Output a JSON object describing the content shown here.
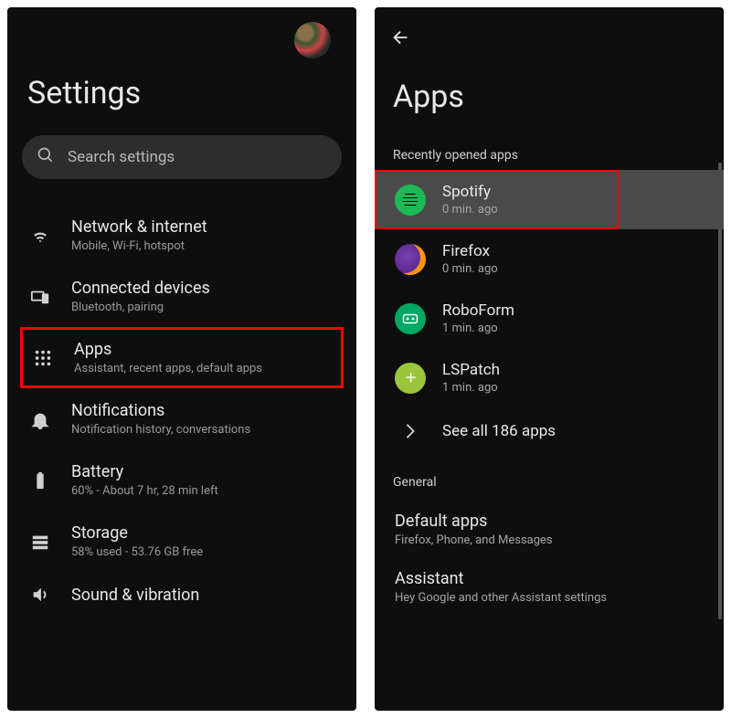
{
  "left": {
    "title": "Settings",
    "search_placeholder": "Search settings",
    "items": [
      {
        "title": "Network & internet",
        "sub": "Mobile, Wi-Fi, hotspot",
        "icon": "wifi-icon"
      },
      {
        "title": "Connected devices",
        "sub": "Bluetooth, pairing",
        "icon": "devices-icon"
      },
      {
        "title": "Apps",
        "sub": "Assistant, recent apps, default apps",
        "icon": "apps-icon",
        "highlighted": true
      },
      {
        "title": "Notifications",
        "sub": "Notification history, conversations",
        "icon": "bell-icon"
      },
      {
        "title": "Battery",
        "sub": "60% - About 7 hr, 28 min left",
        "icon": "battery-icon"
      },
      {
        "title": "Storage",
        "sub": "58% used - 53.76 GB free",
        "icon": "storage-icon"
      },
      {
        "title": "Sound & vibration",
        "sub": "",
        "icon": "sound-icon"
      }
    ]
  },
  "right": {
    "title": "Apps",
    "section_recent": "Recently opened apps",
    "apps": [
      {
        "name": "Spotify",
        "sub": "0 min. ago",
        "icon": "spotify",
        "highlighted": true
      },
      {
        "name": "Firefox",
        "sub": "0 min. ago",
        "icon": "firefox"
      },
      {
        "name": "RoboForm",
        "sub": "1 min. ago",
        "icon": "roboform"
      },
      {
        "name": "LSPatch",
        "sub": "1 min. ago",
        "icon": "lspatch"
      }
    ],
    "see_all": "See all 186 apps",
    "section_general": "General",
    "general": [
      {
        "title": "Default apps",
        "sub": "Firefox, Phone, and Messages"
      },
      {
        "title": "Assistant",
        "sub": "Hey Google and other Assistant settings"
      }
    ]
  }
}
